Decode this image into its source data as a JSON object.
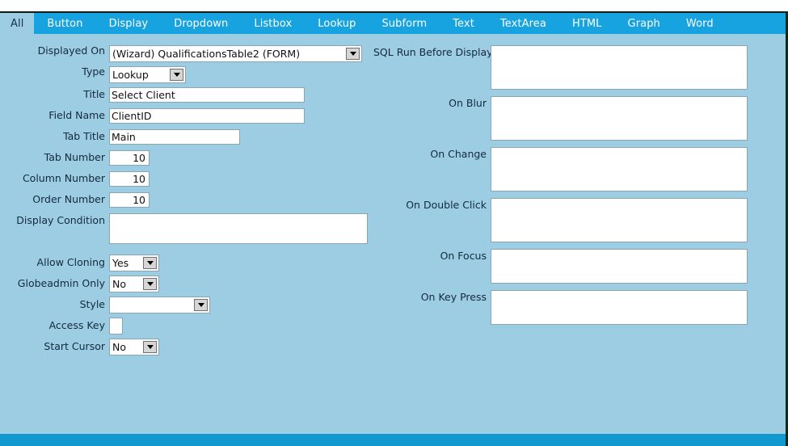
{
  "colors": {
    "tabbar_bg": "#17a3e0",
    "panel_bg": "#9ccde3",
    "bottom_bar": "#1198ce",
    "label_text": "#14293d",
    "input_bg": "#ffffff",
    "input_border": "#8aa5b4",
    "dropdown_button": "#d6d6d6"
  },
  "tabs": [
    {
      "label": "All",
      "active": true
    },
    {
      "label": "Button",
      "active": false
    },
    {
      "label": "Display",
      "active": false
    },
    {
      "label": "Dropdown",
      "active": false
    },
    {
      "label": "Listbox",
      "active": false
    },
    {
      "label": "Lookup",
      "active": false
    },
    {
      "label": "Subform",
      "active": false
    },
    {
      "label": "Text",
      "active": false
    },
    {
      "label": "TextArea",
      "active": false
    },
    {
      "label": "HTML",
      "active": false
    },
    {
      "label": "Graph",
      "active": false
    },
    {
      "label": "Word",
      "active": false
    }
  ],
  "left_form": {
    "displayed_on": {
      "label": "Displayed On",
      "value": "(Wizard) QualificationsTable2 (FORM)"
    },
    "type": {
      "label": "Type",
      "value": "Lookup"
    },
    "title": {
      "label": "Title",
      "value": "Select Client"
    },
    "field_name": {
      "label": "Field Name",
      "value": "ClientID"
    },
    "tab_title": {
      "label": "Tab Title",
      "value": "Main"
    },
    "tab_number": {
      "label": "Tab Number",
      "value": "10"
    },
    "column_number": {
      "label": "Column Number",
      "value": "10"
    },
    "order_number": {
      "label": "Order Number",
      "value": "10"
    },
    "display_condition": {
      "label": "Display Condition",
      "value": ""
    },
    "allow_cloning": {
      "label": "Allow Cloning",
      "value": "Yes"
    },
    "globeadmin_only": {
      "label": "Globeadmin Only",
      "value": "No"
    },
    "style": {
      "label": "Style",
      "value": ""
    },
    "access_key": {
      "label": "Access Key",
      "value": ""
    },
    "start_cursor": {
      "label": "Start Cursor",
      "value": "No"
    }
  },
  "right_form": {
    "sql_run_before_display": {
      "label": "SQL Run Before Display",
      "value": ""
    },
    "on_blur": {
      "label": "On Blur",
      "value": ""
    },
    "on_change": {
      "label": "On Change",
      "value": ""
    },
    "on_double_click": {
      "label": "On Double Click",
      "value": ""
    },
    "on_focus": {
      "label": "On Focus",
      "value": ""
    },
    "on_key_press": {
      "label": "On Key Press",
      "value": ""
    }
  }
}
